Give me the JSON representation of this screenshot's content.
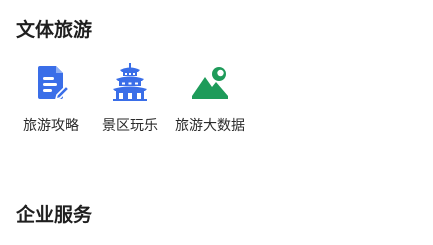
{
  "sections": [
    {
      "title": "文体旅游",
      "items": [
        {
          "label": "旅游攻略",
          "icon": "travel-guide-document-icon",
          "color": "#3a6ee8"
        },
        {
          "label": "景区玩乐",
          "icon": "pagoda-landmark-icon",
          "color": "#3a6ee8"
        },
        {
          "label": "旅游大数据",
          "icon": "mountain-sun-icon",
          "color": "#1e9b5a"
        }
      ]
    },
    {
      "title": "企业服务",
      "items": []
    }
  ]
}
